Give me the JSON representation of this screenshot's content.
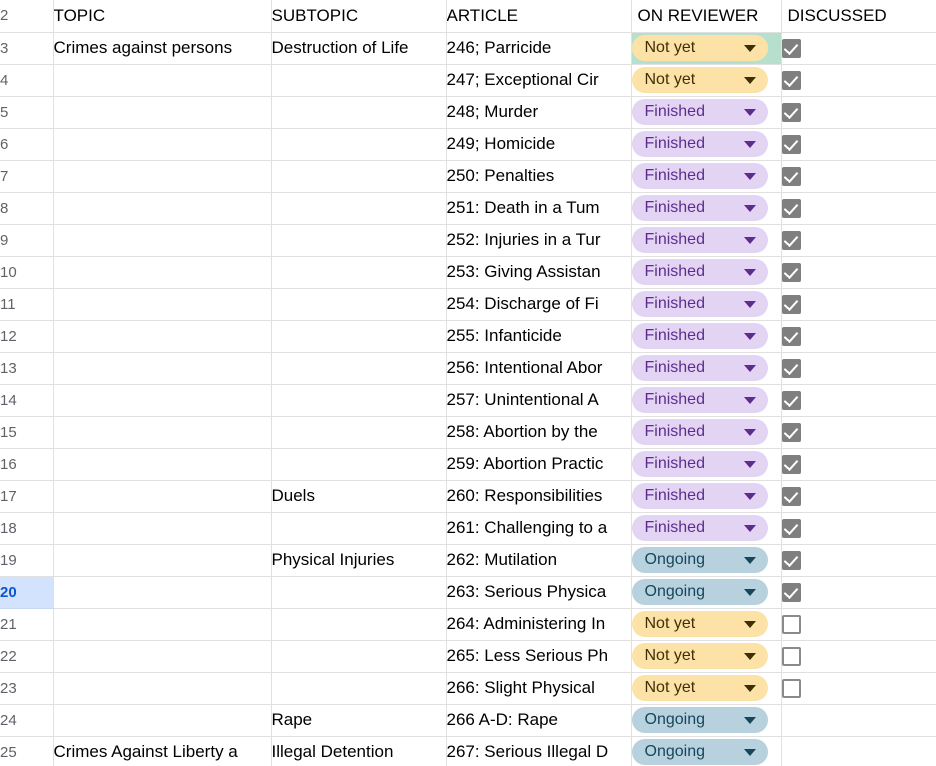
{
  "sheet": {
    "header_row_number": "2",
    "columns": [
      {
        "key": "topic",
        "label": "TOPIC"
      },
      {
        "key": "subtopic",
        "label": "SUBTOPIC"
      },
      {
        "key": "article",
        "label": "ARTICLE"
      },
      {
        "key": "status",
        "label": "ON REVIEWER"
      },
      {
        "key": "discussed",
        "label": "DISCUSSED"
      }
    ],
    "status_options": [
      "Not yet",
      "Ongoing",
      "Finished"
    ],
    "colors": {
      "not_yet_bg": "#fde2a7",
      "not_yet_fg": "#3d2f06",
      "finished_bg": "#e4d4f4",
      "finished_fg": "#5b2d8e",
      "ongoing_bg": "#b7d1de",
      "ongoing_fg": "#17465c",
      "selected_cell_bg": "#b7dfcd",
      "selected_row_header_bg": "#d3e3fd",
      "selected_row_header_fg": "#0b57d0",
      "checkbox_checked": "#7f7f7f",
      "grid_line": "#e0e0e0"
    },
    "rows": [
      {
        "n": "3",
        "topic": "Crimes against persons",
        "subtopic": "Destruction of Life",
        "article": "246; Parricide",
        "status": "Not yet",
        "discussed": "checked",
        "selected": false,
        "status_selected": true
      },
      {
        "n": "4",
        "topic": "",
        "subtopic": "",
        "article": "247; Exceptional Cir",
        "status": "Not yet",
        "discussed": "checked",
        "selected": false,
        "status_selected": false
      },
      {
        "n": "5",
        "topic": "",
        "subtopic": "",
        "article": "248; Murder",
        "status": "Finished",
        "discussed": "checked",
        "selected": false,
        "status_selected": false
      },
      {
        "n": "6",
        "topic": "",
        "subtopic": "",
        "article": "249; Homicide",
        "status": "Finished",
        "discussed": "checked",
        "selected": false,
        "status_selected": false
      },
      {
        "n": "7",
        "topic": "",
        "subtopic": "",
        "article": "250: Penalties",
        "status": "Finished",
        "discussed": "checked",
        "selected": false,
        "status_selected": false
      },
      {
        "n": "8",
        "topic": "",
        "subtopic": "",
        "article": "251: Death in a Tum",
        "status": "Finished",
        "discussed": "checked",
        "selected": false,
        "status_selected": false
      },
      {
        "n": "9",
        "topic": "",
        "subtopic": "",
        "article": "252: Injuries in a Tur",
        "status": "Finished",
        "discussed": "checked",
        "selected": false,
        "status_selected": false
      },
      {
        "n": "10",
        "topic": "",
        "subtopic": "",
        "article": "253: Giving Assistan",
        "status": "Finished",
        "discussed": "checked",
        "selected": false,
        "status_selected": false
      },
      {
        "n": "11",
        "topic": "",
        "subtopic": "",
        "article": "254: Discharge of Fi",
        "status": "Finished",
        "discussed": "checked",
        "selected": false,
        "status_selected": false
      },
      {
        "n": "12",
        "topic": "",
        "subtopic": "",
        "article": "255: Infanticide",
        "status": "Finished",
        "discussed": "checked",
        "selected": false,
        "status_selected": false
      },
      {
        "n": "13",
        "topic": "",
        "subtopic": "",
        "article": "256: Intentional Abor",
        "status": "Finished",
        "discussed": "checked",
        "selected": false,
        "status_selected": false
      },
      {
        "n": "14",
        "topic": "",
        "subtopic": "",
        "article": "257: Unintentional A",
        "status": "Finished",
        "discussed": "checked",
        "selected": false,
        "status_selected": false
      },
      {
        "n": "15",
        "topic": "",
        "subtopic": "",
        "article": "258: Abortion by the",
        "status": "Finished",
        "discussed": "checked",
        "selected": false,
        "status_selected": false
      },
      {
        "n": "16",
        "topic": "",
        "subtopic": "",
        "article": "259: Abortion Practic",
        "status": "Finished",
        "discussed": "checked",
        "selected": false,
        "status_selected": false
      },
      {
        "n": "17",
        "topic": "",
        "subtopic": "Duels",
        "article": "260: Responsibilities",
        "status": "Finished",
        "discussed": "checked",
        "selected": false,
        "status_selected": false
      },
      {
        "n": "18",
        "topic": "",
        "subtopic": "",
        "article": "261: Challenging to a",
        "status": "Finished",
        "discussed": "checked",
        "selected": false,
        "status_selected": false
      },
      {
        "n": "19",
        "topic": "",
        "subtopic": "Physical Injuries",
        "article": "262: Mutilation",
        "status": "Ongoing",
        "discussed": "checked",
        "selected": false,
        "status_selected": false
      },
      {
        "n": "20",
        "topic": "",
        "subtopic": "",
        "article": "263: Serious Physica",
        "status": "Ongoing",
        "discussed": "checked",
        "selected": true,
        "status_selected": false
      },
      {
        "n": "21",
        "topic": "",
        "subtopic": "",
        "article": "264: Administering In",
        "status": "Not yet",
        "discussed": "unchecked",
        "selected": false,
        "status_selected": false
      },
      {
        "n": "22",
        "topic": "",
        "subtopic": "",
        "article": "265: Less Serious Ph",
        "status": "Not yet",
        "discussed": "unchecked",
        "selected": false,
        "status_selected": false
      },
      {
        "n": "23",
        "topic": "",
        "subtopic": "",
        "article": "266: Slight Physical",
        "status": "Not yet",
        "discussed": "unchecked",
        "selected": false,
        "status_selected": false
      },
      {
        "n": "24",
        "topic": "",
        "subtopic": "Rape",
        "article": "266 A-D: Rape",
        "status": "Ongoing",
        "discussed": "none",
        "selected": false,
        "status_selected": false
      },
      {
        "n": "25",
        "topic": "Crimes Against Liberty a",
        "subtopic": "Illegal Detention",
        "article": "267: Serious Illegal D",
        "status": "Ongoing",
        "discussed": "none",
        "selected": false,
        "status_selected": false
      }
    ]
  }
}
